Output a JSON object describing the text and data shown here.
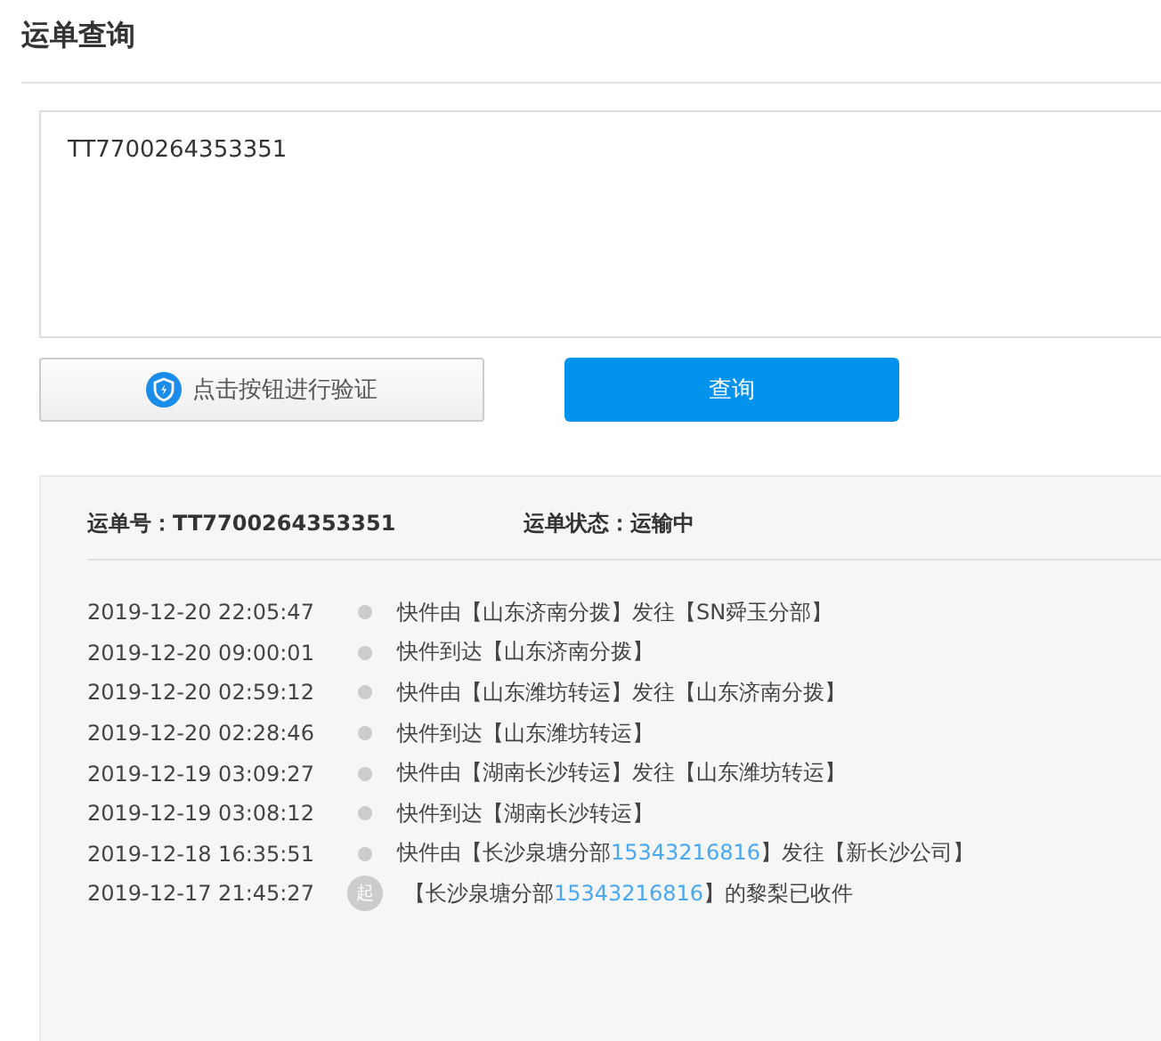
{
  "title": "运单查询",
  "waybill_input": {
    "value": "TT7700264353351"
  },
  "buttons": [
    {
      "kind": "verify",
      "label": "点击按钮进行验证"
    },
    {
      "kind": "primary",
      "label": "查询"
    }
  ],
  "result": {
    "waybill_label": "运单号：",
    "waybill_no": "TT7700264353351",
    "status_label": "运单状态：",
    "status": "运输中",
    "events": [
      {
        "time": "2019-12-20 22:05:47",
        "kind": "dot",
        "text": "快件由【山东济南分拨】发往【SN舜玉分部】"
      },
      {
        "time": "2019-12-20 09:00:01",
        "kind": "dot",
        "text": "快件到达【山东济南分拨】"
      },
      {
        "time": "2019-12-20 02:59:12",
        "kind": "dot",
        "text": "快件由【山东潍坊转运】发往【山东济南分拨】"
      },
      {
        "time": "2019-12-20 02:28:46",
        "kind": "dot",
        "text": "快件到达【山东潍坊转运】"
      },
      {
        "time": "2019-12-19 03:09:27",
        "kind": "dot",
        "text": "快件由【湖南长沙转运】发往【山东潍坊转运】"
      },
      {
        "time": "2019-12-19 03:08:12",
        "kind": "dot",
        "text": "快件到达【湖南长沙转运】"
      },
      {
        "time": "2019-12-18 16:35:51",
        "kind": "dot",
        "text": "快件由【长沙泉塘分部",
        "phone": "15343216816",
        "after": "】发往【新长沙公司】"
      },
      {
        "time": "2019-12-17 21:45:27",
        "kind": "start",
        "marker": "起",
        "text": "【长沙泉塘分部",
        "phone": "15343216816",
        "after": "】的黎梨已收件"
      }
    ]
  }
}
